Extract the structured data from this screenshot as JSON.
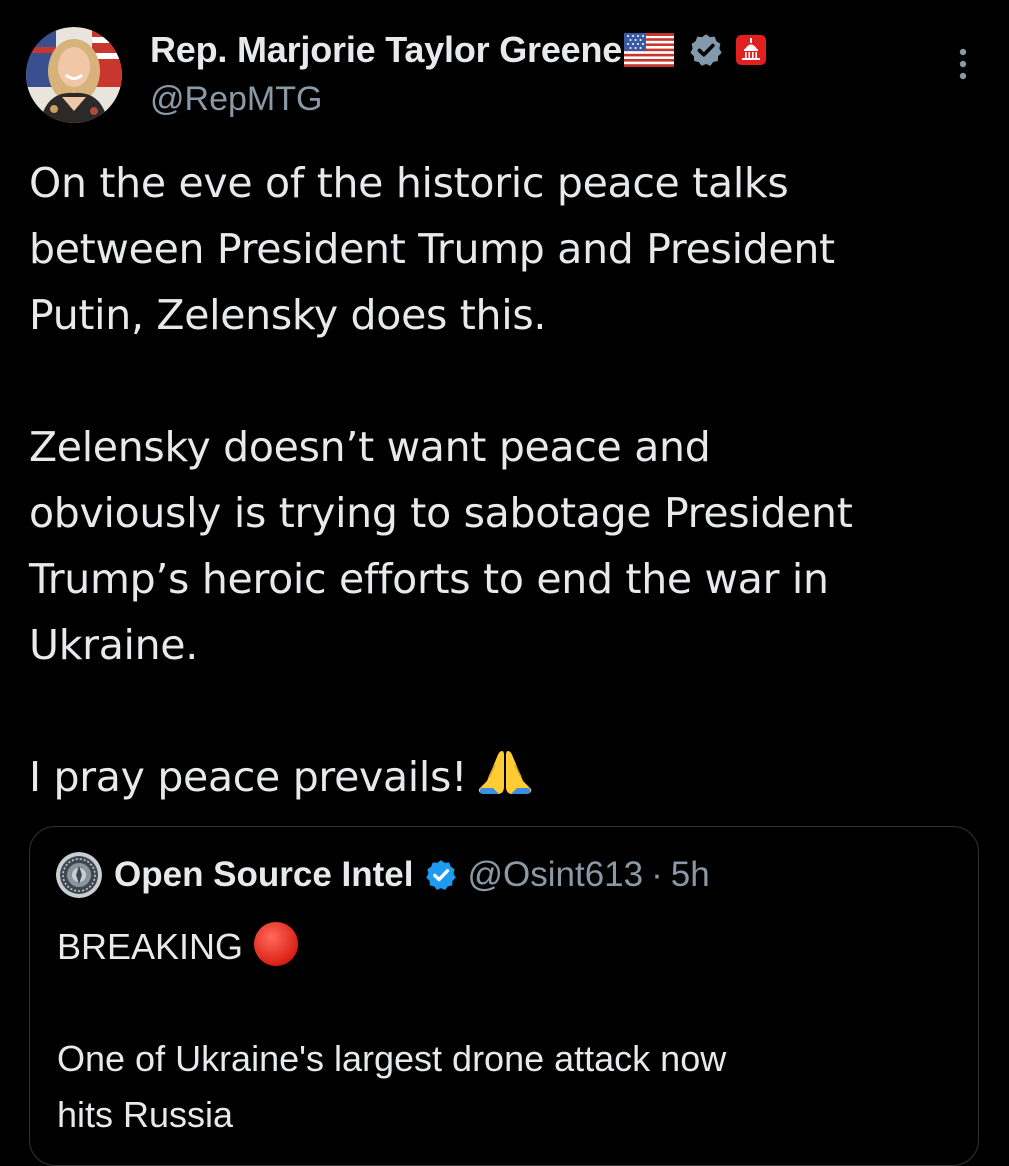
{
  "author": {
    "display_name": "Rep. Marjorie Taylor Greene",
    "handle": "@RepMTG",
    "badges": [
      "us-flag-icon",
      "verified-icon",
      "capitol-icon"
    ]
  },
  "tweet": {
    "paragraph1_line1": "On the eve of the historic peace talks",
    "paragraph1_line2": "between President Trump and President",
    "paragraph1_line3": "Putin, Zelensky does this.",
    "paragraph2_line1": "Zelensky doesn’t want peace and",
    "paragraph2_line2": "obviously is trying to sabotage President",
    "paragraph2_line3": "Trump’s heroic efforts to end the war in",
    "paragraph2_line4": "Ukraine.",
    "paragraph3": "I pray peace prevails!",
    "paragraph3_emoji": "folded-hands-icon"
  },
  "quote": {
    "display_name": "Open Source Intel",
    "handle": "@Osint613",
    "separator": "·",
    "time": "5h",
    "line1": "BREAKING",
    "line1_emoji": "red-circle-icon",
    "line2": "One of Ukraine's largest drone attack now",
    "line3": "hits Russia"
  },
  "colors": {
    "background": "#000000",
    "text": "#e7e9ea",
    "secondary": "#8b98a5",
    "border": "#2f3336",
    "verified_blue": "#1d9bf0",
    "verified_gray": "#829aab",
    "red": "#e0211f"
  }
}
